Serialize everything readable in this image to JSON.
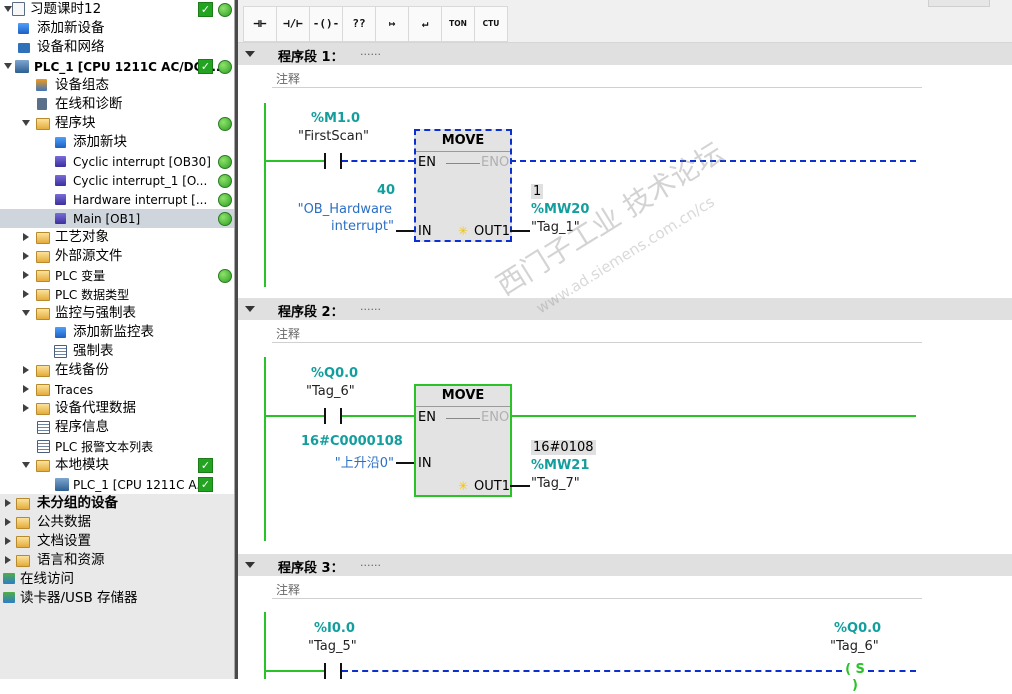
{
  "project_tree": {
    "items": [
      {
        "label": "习题课时12",
        "status": [
          "check",
          "green"
        ]
      },
      {
        "label": "添加新设备"
      },
      {
        "label": "设备和网络"
      },
      {
        "label": "PLC_1 [CPU 1211C AC/DC/...",
        "status": [
          "check",
          "green"
        ]
      },
      {
        "label": "设备组态"
      },
      {
        "label": "在线和诊断"
      },
      {
        "label": "程序块",
        "status": [
          "green"
        ]
      },
      {
        "label": "添加新块"
      },
      {
        "label": "Cyclic interrupt [OB30]",
        "status": [
          "green"
        ]
      },
      {
        "label": "Cyclic interrupt_1 [O...",
        "status": [
          "green"
        ]
      },
      {
        "label": "Hardware interrupt [...",
        "status": [
          "green"
        ]
      },
      {
        "label": "Main [OB1]",
        "status": [
          "green"
        ],
        "selected": true
      },
      {
        "label": "工艺对象"
      },
      {
        "label": "外部源文件"
      },
      {
        "label": "PLC 变量",
        "status": [
          "green"
        ]
      },
      {
        "label": "PLC 数据类型"
      },
      {
        "label": "监控与强制表"
      },
      {
        "label": "添加新监控表"
      },
      {
        "label": "强制表"
      },
      {
        "label": "在线备份"
      },
      {
        "label": "Traces"
      },
      {
        "label": "设备代理数据"
      },
      {
        "label": "程序信息"
      },
      {
        "label": "PLC 报警文本列表"
      },
      {
        "label": "本地模块",
        "status": [
          "check"
        ]
      },
      {
        "label": "PLC_1 [CPU 1211C A...",
        "status": [
          "check"
        ]
      },
      {
        "label": "未分组的设备"
      },
      {
        "label": "公共数据"
      },
      {
        "label": "文档设置"
      },
      {
        "label": "语言和资源"
      },
      {
        "label": "在线访问"
      },
      {
        "label": "读卡器/USB 存储器"
      }
    ]
  },
  "toolbar": {
    "buttons": [
      {
        "label": "⊣⊢",
        "icon": "normally-open-contact-icon"
      },
      {
        "label": "⊣/⊢",
        "icon": "normally-closed-contact-icon"
      },
      {
        "label": "-()-",
        "icon": "coil-icon"
      },
      {
        "label": "??",
        "icon": "empty-box-icon"
      },
      {
        "label": "↦",
        "icon": "open-branch-icon"
      },
      {
        "label": "↵",
        "icon": "close-branch-icon"
      },
      {
        "label": "TON",
        "icon": "ton-timer-icon"
      },
      {
        "label": "CTU",
        "icon": "ctu-counter-icon"
      }
    ]
  },
  "networks": [
    {
      "title": "程序段 1：",
      "dots": "......",
      "comment": "注释",
      "contact": {
        "address": "%M1.0",
        "name": "\"FirstScan\""
      },
      "box": {
        "name": "MOVE",
        "en": "EN",
        "eno": "ENO",
        "in": "IN",
        "out": "OUT1"
      },
      "input": {
        "value": "40",
        "name_line1": "\"OB_Hardware",
        "name_line2": "interrupt\""
      },
      "output": {
        "value": "1",
        "address": "%MW20",
        "name": "\"Tag_1\""
      }
    },
    {
      "title": "程序段 2：",
      "dots": "......",
      "comment": "注释",
      "contact": {
        "address": "%Q0.0",
        "name": "\"Tag_6\""
      },
      "box": {
        "name": "MOVE",
        "en": "EN",
        "eno": "ENO",
        "in": "IN",
        "out": "OUT1"
      },
      "input": {
        "value": "16#C0000108",
        "name": "\"上升沿0\""
      },
      "output": {
        "value": "16#0108",
        "address": "%MW21",
        "name": "\"Tag_7\""
      }
    },
    {
      "title": "程序段 3：",
      "dots": "......",
      "comment": "注释",
      "contact": {
        "address": "%I0.0",
        "name": "\"Tag_5\""
      },
      "coil": {
        "address": "%Q0.0",
        "name": "\"Tag_6\"",
        "symbol": "( S )"
      }
    }
  ],
  "watermark": {
    "line1": "西门子工业 技术论坛",
    "line2": "www.ad.siemens.com.cn/cs"
  },
  "colors": {
    "energized": "#29c229",
    "not_energized": "#0b2fd1",
    "address": "#139e9e"
  }
}
